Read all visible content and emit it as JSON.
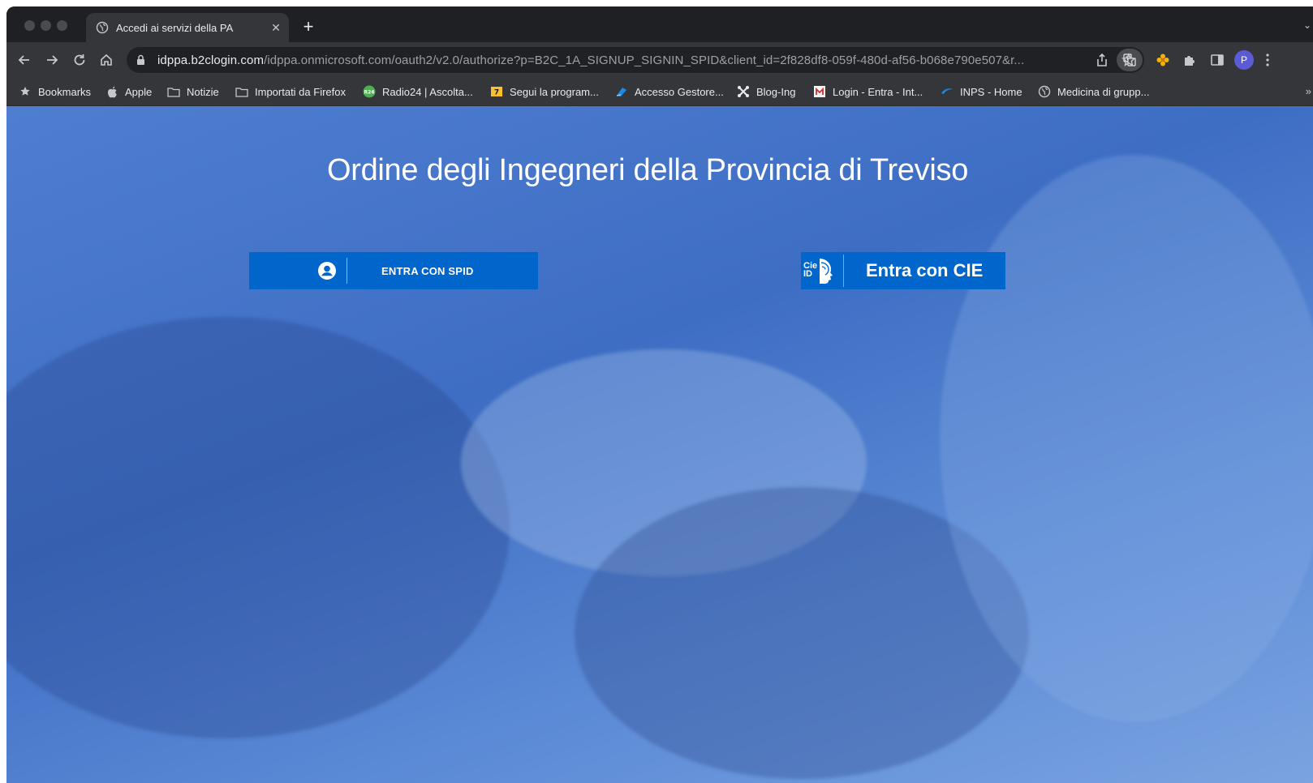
{
  "browser": {
    "tab": {
      "title": "Accedi ai servizi della PA"
    },
    "url": {
      "host": "idppa.b2clogin.com",
      "path": "/idppa.onmicrosoft.com/oauth2/v2.0/authorize?p=B2C_1A_SIGNUP_SIGNIN_SPID&client_id=2f828df8-059f-480d-af56-b068e790e507&r..."
    },
    "avatar_letter": "P",
    "bookmarks": [
      {
        "label": "Bookmarks",
        "icon": "star-icon"
      },
      {
        "label": "Apple",
        "icon": "apple-icon"
      },
      {
        "label": "Notizie",
        "icon": "folder-icon"
      },
      {
        "label": "Importati da Firefox",
        "icon": "folder-icon"
      },
      {
        "label": "Radio24 | Ascolta...",
        "icon": "radio24-icon"
      },
      {
        "label": "Segui la program...",
        "icon": "program-icon"
      },
      {
        "label": "Accesso Gestore...",
        "icon": "gestore-icon"
      },
      {
        "label": "Blog-Ing",
        "icon": "joomla-icon"
      },
      {
        "label": "Login - Entra - Int...",
        "icon": "login-icon"
      },
      {
        "label": "INPS - Home",
        "icon": "inps-icon"
      },
      {
        "label": "Medicina di grupp...",
        "icon": "globe-icon"
      }
    ]
  },
  "page": {
    "title": "Ordine degli Ingegneri della Provincia di Treviso",
    "spid_button": "ENTRA CON SPID",
    "cie_button": "Entra con CIE",
    "cie_logo_text": "Cie ID"
  },
  "colors": {
    "button": "#0066cc",
    "overlay": "#3e6ec4",
    "chrome_dark": "#1f2023",
    "chrome_toolbar": "#35363a"
  }
}
